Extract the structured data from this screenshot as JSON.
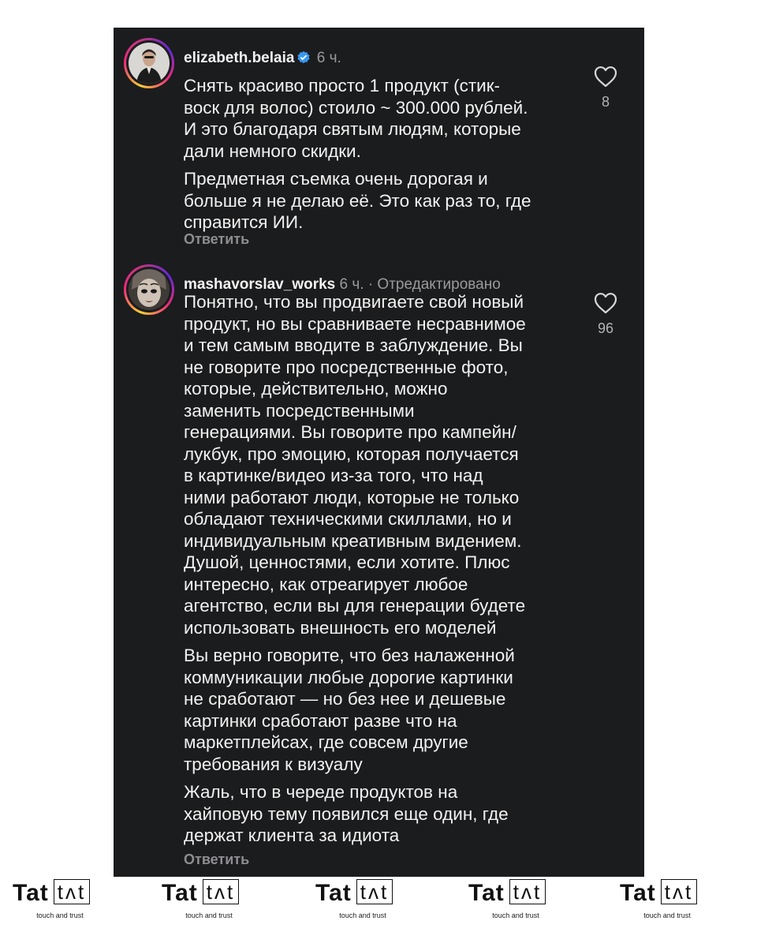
{
  "comments": [
    {
      "username": "elizabeth.belaia",
      "verified": true,
      "time": "6 ч.",
      "edited": "",
      "paragraphs": [
        "Снять красиво просто 1 продукт (стик-\nвоск для волос) стоило ~ 300.000 рублей.\nИ это благодаря святым людям, которые\nдали немного скидки.",
        "Предметная съемка очень дорогая и\nбольше я не делаю её. Это как раз то, где\nсправится ИИ."
      ],
      "likes": "8",
      "reply_label": "Ответить"
    },
    {
      "username": "mashavorslav_works",
      "verified": false,
      "time": "6 ч.",
      "edited": "· Отредактировано",
      "paragraphs": [
        "Понятно, что вы продвигаете свой новый\nпродукт, но вы сравниваете несравнимое\nи тем самым вводите в заблуждение. Вы\nне говорите про посредственные фото,\nкоторые, действительно, можно\nзаменить посредственными\nгенерациями. Вы говорите про кампейн/\nлукбук, про эмоцию, которая получается\nв картинке/видео из-за того, что над\nними работают люди, которые не только\nобладают техническими скиллами, но и\nиндивидуальным креативным видением.\nДушой, ценностями, если хотите. Плюс\nинтересно, как отреагирует любое\nагентство, если вы для генерации будете\nиспользовать внешность его моделей",
        "Вы верно говорите, что без налаженной\nкоммуникации любые дорогие картинки\nне сработают — но без нее и дешевые\nкартинки сработают разве что на\nмаркетплейсах, где совсем другие\nтребования к визуалу",
        "Жаль, что в череде продуктов на\nхайповую тему появился еще один, где\nдержат клиента за идиота"
      ],
      "likes": "96",
      "reply_label": "Ответить"
    }
  ],
  "watermark": {
    "brand": "Tat",
    "logo": "tʌt",
    "tagline": "touch and trust"
  },
  "colors": {
    "panel_bg": "#1b1c1e",
    "text": "#f2f2f2",
    "meta": "#9a9a9d",
    "verified": "#3897f0"
  },
  "icons": {
    "like": "heart-outline-icon",
    "verified": "verified-badge-icon"
  }
}
